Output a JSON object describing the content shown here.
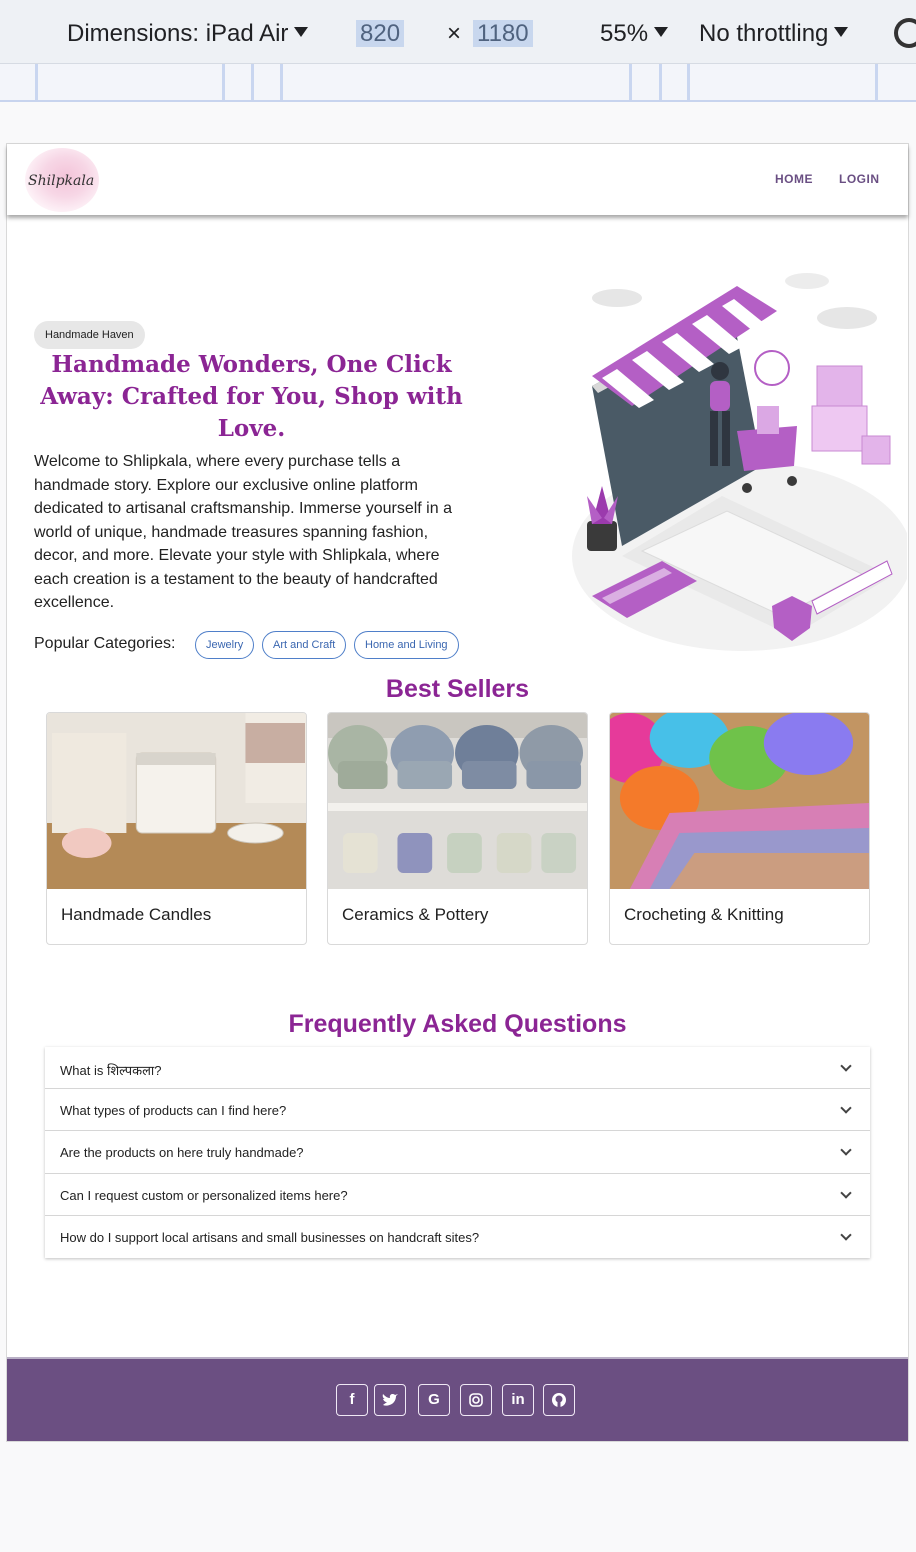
{
  "devtools": {
    "dimensions_label": "Dimensions: iPad Air",
    "width": "820",
    "times": "×",
    "height": "1180",
    "zoom": "55%",
    "throttling": "No throttling",
    "rotate_icon": "rotate-icon"
  },
  "navbar": {
    "logo_text": "Shilpkala",
    "links": [
      "HOME",
      "LOGIN"
    ]
  },
  "hero": {
    "badge": "Handmade Haven",
    "title": "Handmade Wonders, One Click Away: Crafted for You, Shop with Love.",
    "description": "Welcome to Shlipkala, where every purchase tells a handmade story. Explore our exclusive online platform dedicated to artisanal craftsmanship. Immerse yourself in a world of unique, handmade treasures spanning fashion, decor, and more. Elevate your style with Shlipkala, where each creation is a testament to the beauty of handcrafted excellence.",
    "categories_label": "Popular Categories:",
    "categories": [
      "Jewelry",
      "Art and Craft",
      "Home and Living"
    ]
  },
  "best_sellers": {
    "title": "Best Sellers",
    "cards": [
      {
        "title": "Handmade Candles"
      },
      {
        "title": "Ceramics & Pottery"
      },
      {
        "title": "Crocheting & Knitting"
      }
    ]
  },
  "faq": {
    "title": "Frequently Asked Questions",
    "items": [
      "What is शिल्पकला?",
      "What types of products can I find here?",
      "Are the products on here truly handmade?",
      "Can I request custom or personalized items here?",
      "How do I support local artisans and small businesses on handcraft sites?"
    ]
  },
  "footer": {
    "social_icons": [
      "facebook-icon",
      "twitter-icon",
      "google-icon",
      "instagram-icon",
      "linkedin-icon",
      "github-icon"
    ]
  },
  "colors": {
    "brand_purple": "#8b2594",
    "footer_purple": "#6b4f82",
    "chip_blue": "#3a66b0"
  }
}
